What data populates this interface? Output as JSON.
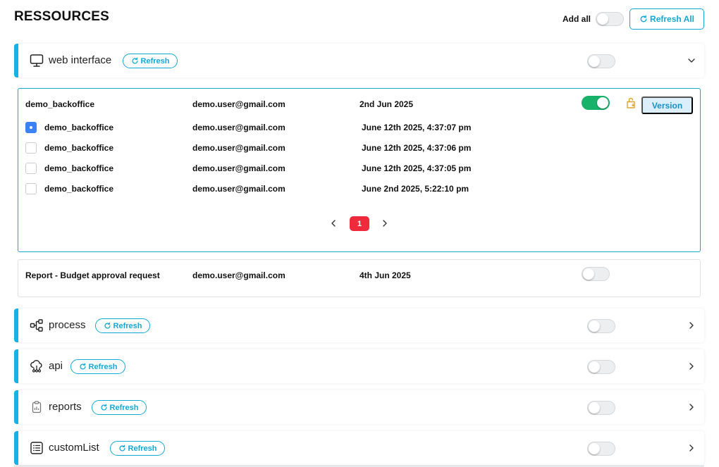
{
  "header": {
    "title": "RESSOURCES",
    "add_all_label": "Add all",
    "refresh_all_label": "Refresh All"
  },
  "sections": {
    "web": {
      "title": "web interface",
      "refresh_label": "Refresh",
      "icon": "monitor-icon"
    },
    "process": {
      "title": "process",
      "refresh_label": "Refresh",
      "icon": "flow-icon"
    },
    "api": {
      "title": "api",
      "refresh_label": "Refresh",
      "icon": "cloud-network-icon"
    },
    "reports": {
      "title": "reports",
      "refresh_label": "Refresh",
      "icon": "clipboard-icon"
    },
    "customList": {
      "title": "customList",
      "refresh_label": "Refresh",
      "icon": "list-icon"
    }
  },
  "resource": {
    "name": "demo_backoffice",
    "user": "demo.user@gmail.com",
    "date": "2nd Jun 2025",
    "version_label": "Version",
    "versions": [
      {
        "name": "demo_backoffice",
        "user": "demo.user@gmail.com",
        "timestamp": "June 12th 2025, 4:37:07 pm",
        "selected": true
      },
      {
        "name": "demo_backoffice",
        "user": "demo.user@gmail.com",
        "timestamp": "June 12th 2025, 4:37:06 pm",
        "selected": false
      },
      {
        "name": "demo_backoffice",
        "user": "demo.user@gmail.com",
        "timestamp": "June 12th 2025, 4:37:05 pm",
        "selected": false
      },
      {
        "name": "demo_backoffice",
        "user": "demo.user@gmail.com",
        "timestamp": "June 2nd 2025, 5:22:10 pm",
        "selected": false
      }
    ],
    "pagination": {
      "current_page": "1"
    }
  },
  "report": {
    "name": "Report - Budget approval request",
    "user": "demo.user@gmail.com",
    "date": "4th Jun 2025"
  },
  "colors": {
    "accent": "#16b2e6",
    "toggle_on": "#18b26b",
    "page_active": "#ee2a3c",
    "version_bg": "#dbeefa"
  }
}
